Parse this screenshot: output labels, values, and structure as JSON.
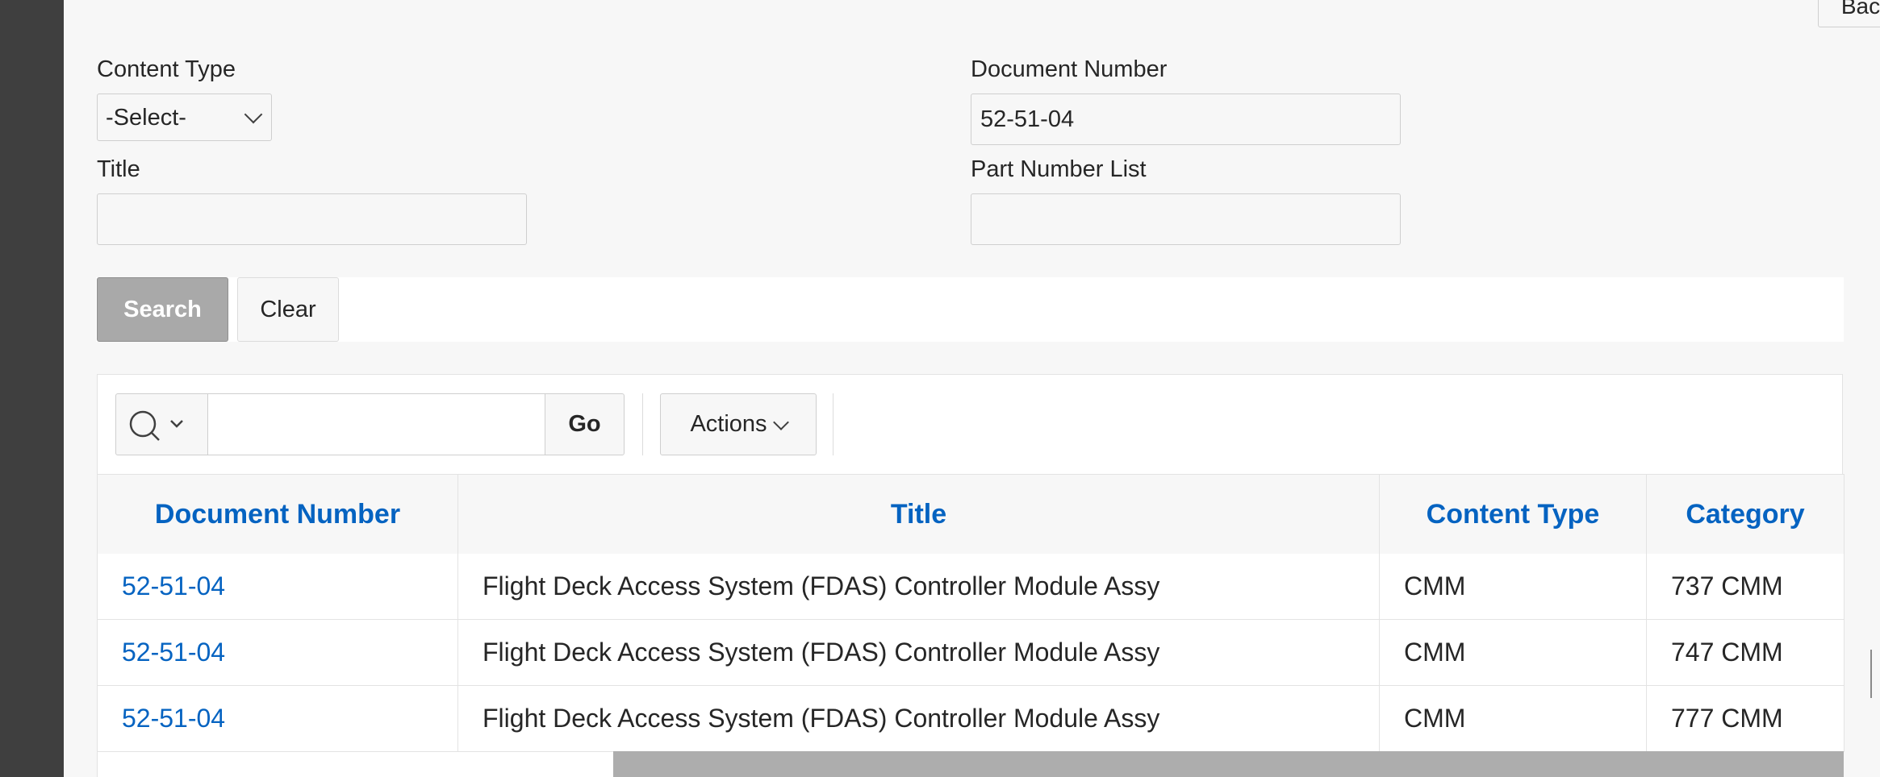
{
  "header": {
    "back_label": "Back"
  },
  "form": {
    "content_type": {
      "label": "Content Type",
      "value": "-Select-"
    },
    "document_number": {
      "label": "Document Number",
      "value": "52-51-04"
    },
    "title": {
      "label": "Title",
      "value": ""
    },
    "part_number_list": {
      "label": "Part Number List",
      "value": ""
    }
  },
  "buttons": {
    "search": "Search",
    "clear": "Clear"
  },
  "toolbar": {
    "search_value": "",
    "go": "Go",
    "actions": "Actions"
  },
  "report": {
    "columns": [
      "Document Number",
      "Title",
      "Content Type",
      "Category"
    ],
    "rows": [
      [
        "52-51-04",
        "Flight Deck Access System (FDAS) Controller Module Assy",
        "CMM",
        "737 CMM"
      ],
      [
        "52-51-04",
        "Flight Deck Access System (FDAS) Controller Module Assy",
        "CMM",
        "747 CMM"
      ],
      [
        "52-51-04",
        "Flight Deck Access System (FDAS) Controller Module Assy",
        "CMM",
        "777 CMM"
      ]
    ]
  }
}
